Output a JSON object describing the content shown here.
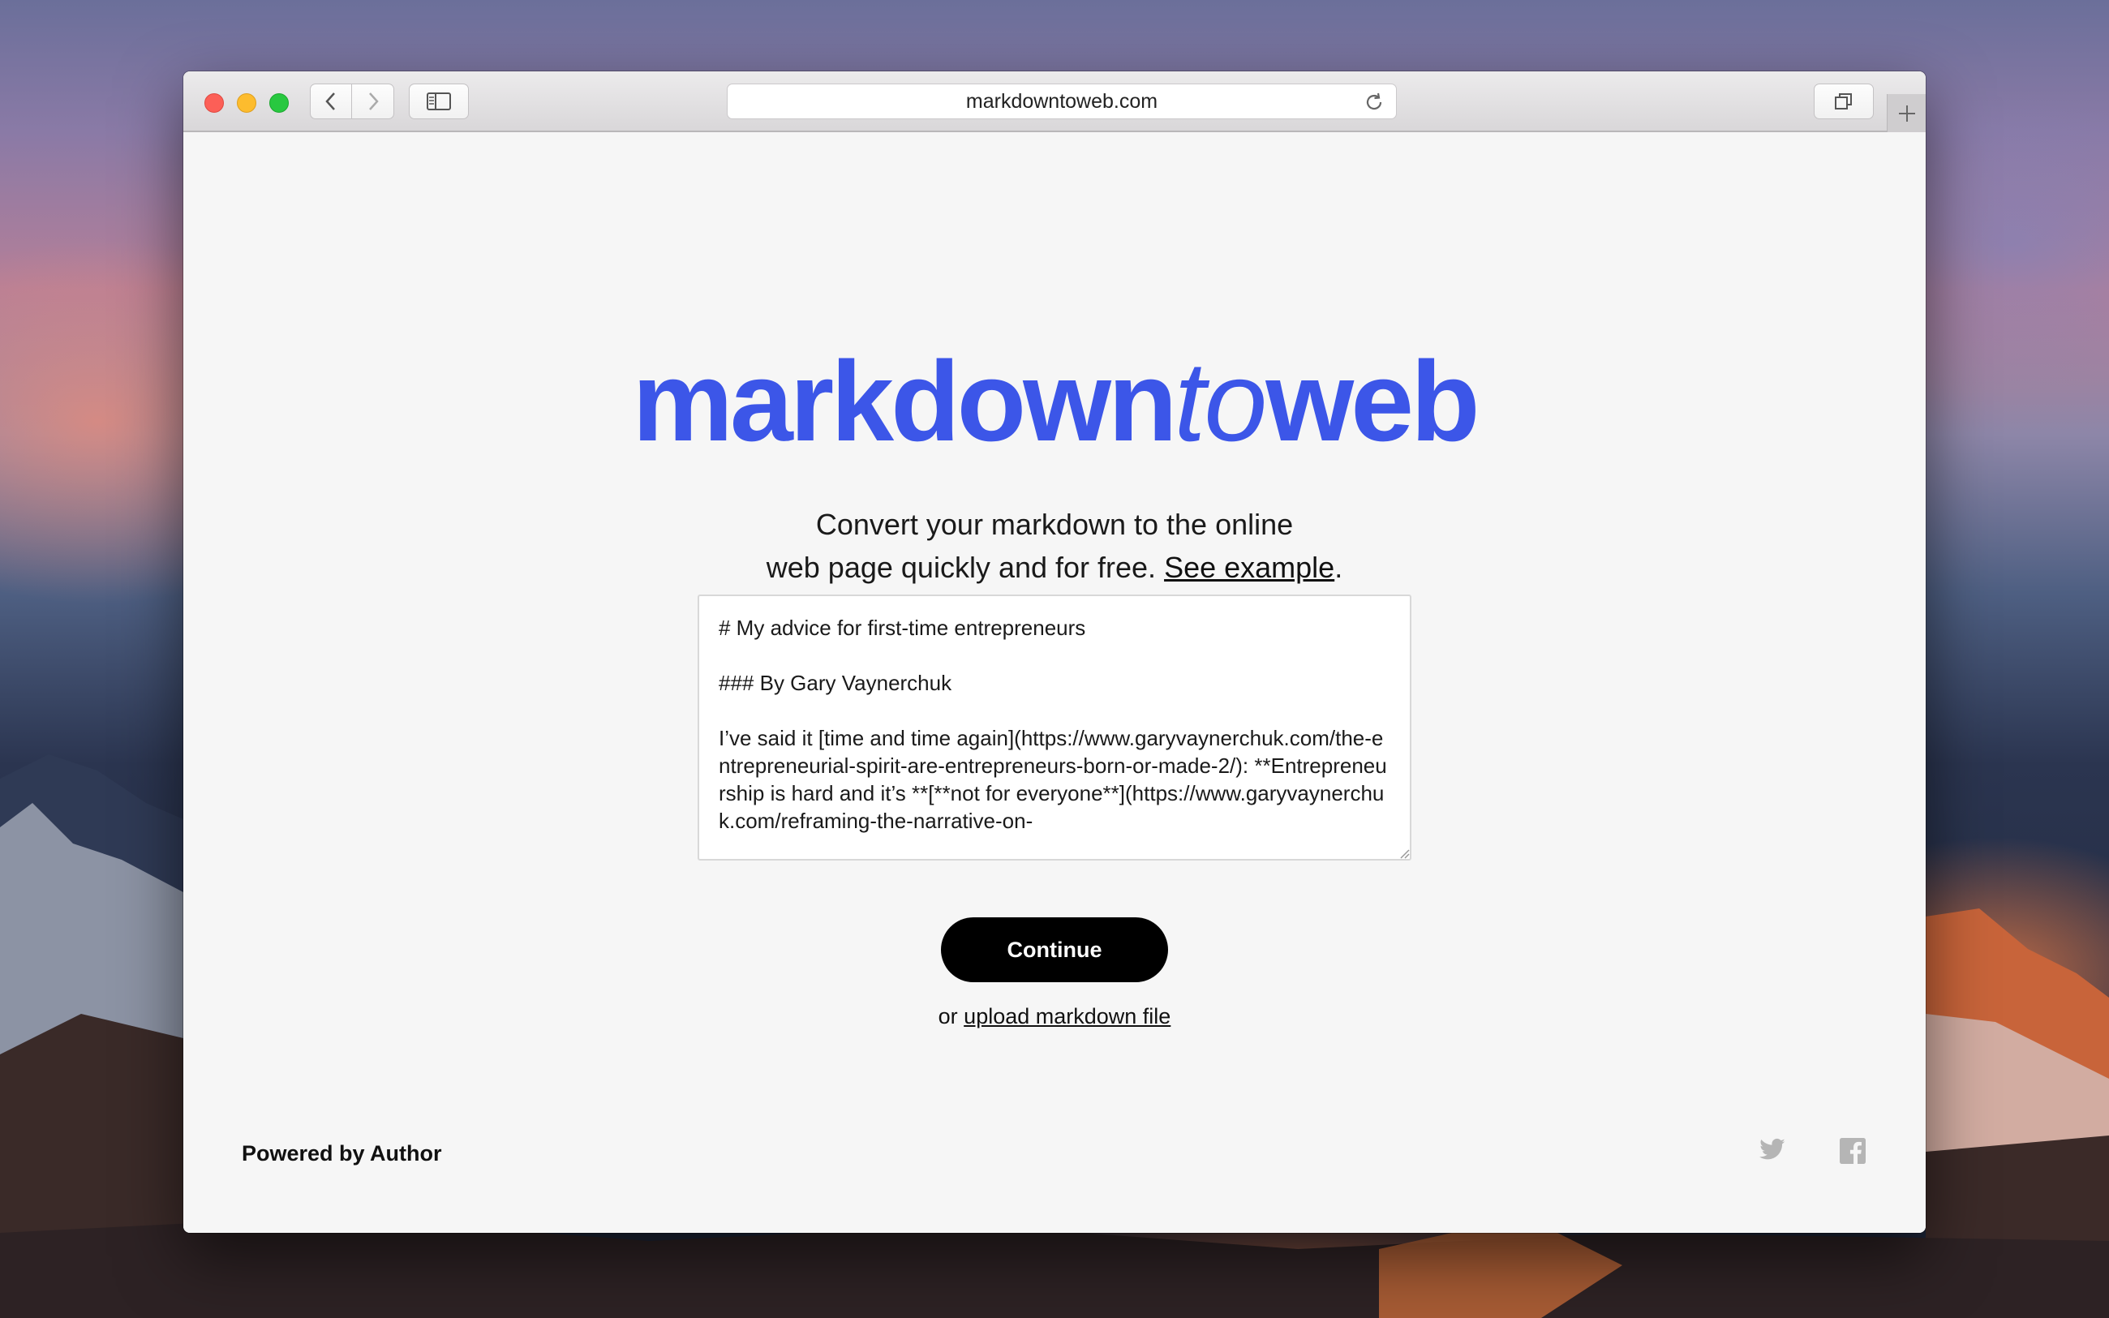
{
  "browser": {
    "url": "markdowntoweb.com"
  },
  "logo": {
    "part1": "markdown",
    "part2": "to",
    "part3": "web"
  },
  "tagline": {
    "line1": "Convert your markdown to the online",
    "line2_prefix": "web page quickly and for free. ",
    "link": "See example",
    "line2_suffix": "."
  },
  "editor": {
    "value": "# My advice for first-time entrepreneurs\n\n### By Gary Vaynerchuk\n\nI’ve said it [time and time again](https://www.garyvaynerchuk.com/the-entrepreneurial-spirit-are-entrepreneurs-born-or-made-2/): **Entrepreneurship is hard and it’s **[**not for everyone**](https://www.garyvaynerchuk.com/reframing-the-narrative-on-"
  },
  "actions": {
    "continue_label": "Continue",
    "upload_prefix": "or ",
    "upload_link": "upload markdown file"
  },
  "footer": {
    "powered": "Powered by Author"
  },
  "colors": {
    "brand": "#3c56e8",
    "button": "#000000"
  },
  "icons": {
    "back": "chevron-left-icon",
    "forward": "chevron-right-icon",
    "sidebar": "sidebar-icon",
    "reload": "reload-icon",
    "tabs": "tabs-overview-icon",
    "new_tab": "plus-icon",
    "twitter": "twitter-icon",
    "facebook": "facebook-icon"
  }
}
